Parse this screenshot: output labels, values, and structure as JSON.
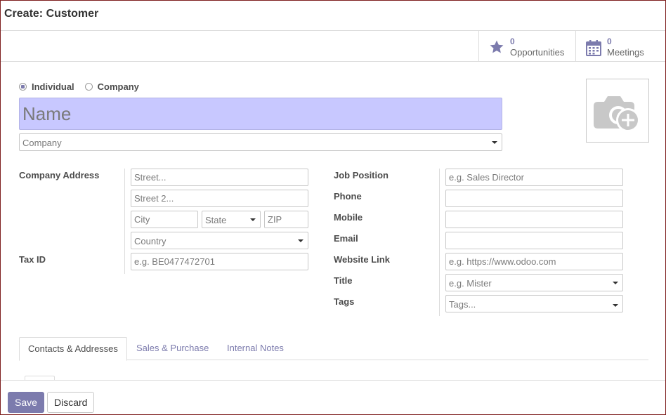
{
  "header": {
    "title": "Create: Customer"
  },
  "smart_buttons": [
    {
      "count": "0",
      "label": "Opportunities",
      "icon": "star-icon"
    },
    {
      "count": "0",
      "label": "Meetings",
      "icon": "calendar-icon"
    }
  ],
  "type_selector": {
    "individual_label": "Individual",
    "company_label": "Company",
    "selected": "Individual"
  },
  "name": {
    "placeholder": "Name",
    "value": ""
  },
  "company": {
    "placeholder": "Company"
  },
  "address": {
    "label": "Company Address",
    "street_placeholder": "Street...",
    "street2_placeholder": "Street 2...",
    "city_placeholder": "City",
    "state_placeholder": "State",
    "zip_placeholder": "ZIP",
    "country_placeholder": "Country"
  },
  "tax_id": {
    "label": "Tax ID",
    "placeholder": "e.g. BE0477472701"
  },
  "right_fields": {
    "job_position": {
      "label": "Job Position",
      "placeholder": "e.g. Sales Director"
    },
    "phone": {
      "label": "Phone",
      "placeholder": ""
    },
    "mobile": {
      "label": "Mobile",
      "placeholder": ""
    },
    "email": {
      "label": "Email",
      "placeholder": ""
    },
    "website": {
      "label": "Website Link",
      "placeholder": "e.g. https://www.odoo.com"
    },
    "title": {
      "label": "Title",
      "placeholder": "e.g. Mister"
    },
    "tags": {
      "label": "Tags",
      "placeholder": "Tags..."
    }
  },
  "tabs": [
    {
      "label": "Contacts & Addresses",
      "active": true
    },
    {
      "label": "Sales & Purchase",
      "active": false
    },
    {
      "label": "Internal Notes",
      "active": false
    }
  ],
  "footer": {
    "save_label": "Save",
    "discard_label": "Discard"
  },
  "colors": {
    "accent": "#7c7bad",
    "name_highlight": "#c8c8ff",
    "frame_border": "#7d1e1e"
  }
}
